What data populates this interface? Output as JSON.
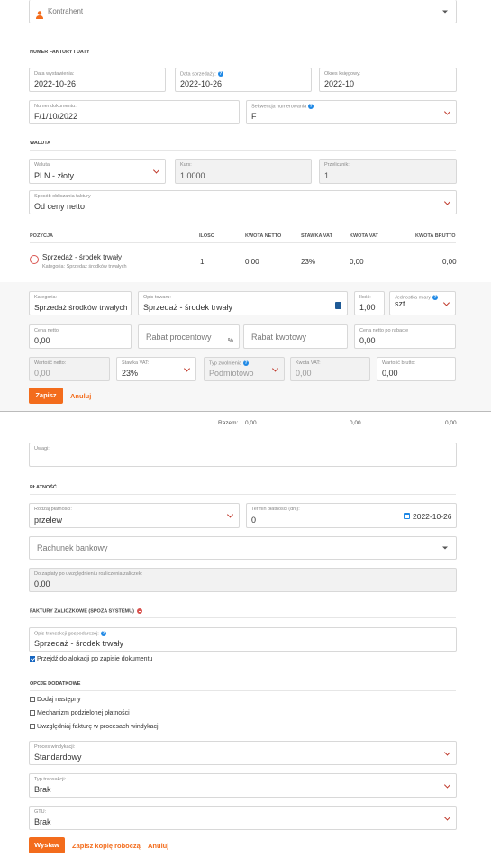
{
  "contractor": {
    "placeholder": "Kontrahent"
  },
  "invoice_section": {
    "title": "NUMER FAKTURY I DATY",
    "issue_date": {
      "label": "Data wystawienia:",
      "value": "2022-10-26"
    },
    "sale_date": {
      "label": "Data sprzedaży:",
      "value": "2022-10-26"
    },
    "tax_period": {
      "label": "Okres księgowy:",
      "value": "2022-10"
    },
    "doc_number": {
      "label": "Numer dokumentu:",
      "value": "F/1/10/2022"
    },
    "sequence": {
      "label": "Sekwencja numerowania",
      "value": "F"
    }
  },
  "currency_section": {
    "title": "WALUTA",
    "currency": {
      "label": "Waluta:",
      "value": "PLN - złoty"
    },
    "rate": {
      "label": "Kurs:",
      "value": "1.0000"
    },
    "multiplier": {
      "label": "Przelicznik:",
      "value": "1"
    },
    "calc_method": {
      "label": "Sposób obliczania faktury",
      "value": "Od ceny netto"
    }
  },
  "items_table": {
    "headers": {
      "position": "POZYCJA",
      "qty": "ILOŚĆ",
      "net": "KWOTA NETTO",
      "vat_rate": "STAWKA VAT",
      "vat": "KWOTA VAT",
      "gross": "KWOTA BRUTTO"
    },
    "row": {
      "name": "Sprzedaż - środek trwały",
      "category": "Kategoria: Sprzedaż środków trwałych",
      "qty": "1",
      "net": "0,00",
      "vat_rate": "23%",
      "vat": "0,00",
      "gross": "0,00"
    }
  },
  "editor": {
    "category": {
      "label": "Kategoria:",
      "value": "Sprzedaż środków trwałych"
    },
    "description": {
      "label": "Opis towaru:",
      "value": "Sprzedaż - środek trwały"
    },
    "qty": {
      "label": "Ilość:",
      "value": "1,00"
    },
    "unit": {
      "label": "Jednostka miary",
      "value": "szt."
    },
    "net_price": {
      "label": "Cena netto:",
      "value": "0,00"
    },
    "discount_pct": {
      "placeholder": "Rabat procentowy",
      "suffix": "%"
    },
    "discount_amt": {
      "placeholder": "Rabat kwotowy"
    },
    "net_after": {
      "label": "Cena netto po rabacie",
      "value": "0,00"
    },
    "net_value": {
      "label": "Wartość netto:",
      "value": "0,00"
    },
    "vat_rate": {
      "label": "Stawka VAT:",
      "value": "23%"
    },
    "exemption": {
      "label": "Typ zwolnienia",
      "value": "Podmiotowo"
    },
    "vat_amount": {
      "label": "Kwota VAT:",
      "value": "0,00"
    },
    "gross_value": {
      "label": "Wartość brutto:",
      "value": "0,00"
    },
    "save": "Zapisz",
    "cancel": "Anuluj"
  },
  "totals": {
    "label": "Razem:",
    "net": "0,00",
    "vat": "0,00",
    "gross": "0,00"
  },
  "notes": {
    "label": "Uwagi:"
  },
  "payment": {
    "title": "PŁATNOŚĆ",
    "method": {
      "label": "Rodzaj płatności:",
      "value": "przelew"
    },
    "term": {
      "label": "Termin płatności (dni):",
      "value": "0"
    },
    "due_date": "2022-10-26",
    "bank_account": {
      "placeholder": "Rachunek bankowy"
    },
    "to_pay": {
      "label": "Do zapłaty po uwzględnieniu rozliczenia zaliczek:",
      "value": "0.00"
    }
  },
  "advance_section": {
    "title": "FAKTURY ZALICZKOWE (SPOZA SYSTEMU)",
    "transaction_desc": {
      "label": "Opis transakcji gospodarczej:",
      "value": "Sprzedaż - środek trwały"
    },
    "allocate_checkbox": "Przejdź do alokacji po zapisie dokumentu"
  },
  "options": {
    "title": "OPCJE DODATKOWE",
    "add_next": "Dodaj następny",
    "split_payment": "Mechanizm podzielonej płatności",
    "debt_collection": "Uwzględniaj fakturę w procesach windykacji",
    "collection_process": {
      "label": "Proces windykacji:",
      "value": "Standardowy"
    },
    "transaction_type": {
      "label": "Typ transakcji:",
      "value": "Brak"
    },
    "gtu": {
      "label": "GTU:",
      "value": "Brak"
    }
  },
  "footer": {
    "issue": "Wystaw",
    "save_draft": "Zapisz kopię roboczą",
    "cancel": "Anuluj"
  },
  "colors": {
    "accent": "#f36c1c",
    "error": "#c0392b",
    "info": "#1e88e5"
  }
}
